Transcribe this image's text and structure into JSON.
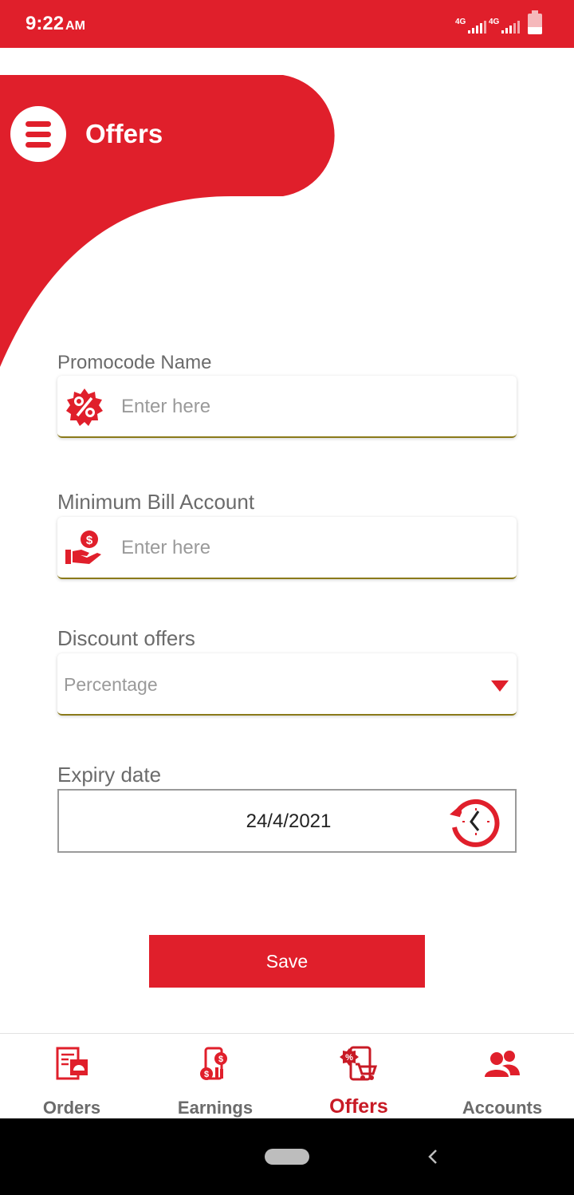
{
  "status_bar": {
    "time": "9:22",
    "ampm": "AM",
    "network1": "4G",
    "network2": "4G"
  },
  "header": {
    "title": "Offers"
  },
  "form": {
    "promocode": {
      "label": "Promocode Name",
      "placeholder": "Enter here",
      "value": ""
    },
    "min_bill": {
      "label": "Minimum Bill Account",
      "placeholder": "Enter here",
      "value": ""
    },
    "discount": {
      "label": "Discount offers",
      "selected": "Percentage"
    },
    "expiry": {
      "label": "Expiry date",
      "value": "24/4/2021"
    },
    "save_label": "Save"
  },
  "bottom_nav": {
    "items": [
      {
        "label": "Orders",
        "icon": "orders-icon",
        "active": false
      },
      {
        "label": "Earnings",
        "icon": "earnings-icon",
        "active": false
      },
      {
        "label": "Offers",
        "icon": "offers-icon",
        "active": true
      },
      {
        "label": "Accounts",
        "icon": "accounts-icon",
        "active": false
      }
    ]
  },
  "colors": {
    "accent": "#e01f2b",
    "active_nav": "#c81a25",
    "label_gray": "#6b6b6b"
  }
}
